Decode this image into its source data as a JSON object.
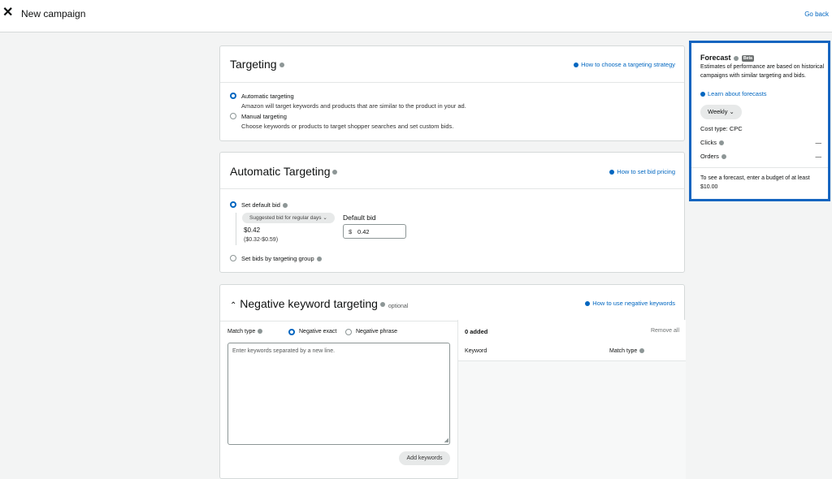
{
  "header": {
    "close_icon": "close-icon",
    "title": "New campaign",
    "go_back": "Go back"
  },
  "targeting": {
    "title": "Targeting",
    "help_link": "How to choose a targeting strategy",
    "options": [
      {
        "label": "Automatic targeting",
        "desc": "Amazon will target keywords and products that are similar to the product in your ad.",
        "selected": true
      },
      {
        "label": "Manual targeting",
        "desc": "Choose keywords or products to target shopper searches and set custom bids.",
        "selected": false
      }
    ]
  },
  "auto": {
    "title": "Automatic Targeting",
    "help_link": "How to set bid pricing",
    "default_bid_label": "Set default bid",
    "suggested_dropdown": "Suggested bid for regular days",
    "suggested_value": "$0.42",
    "suggested_range": "($0.32-$0.59)",
    "default_bid_heading": "Default bid",
    "currency": "$",
    "bid_value": "0.42",
    "group_label": "Set bids by targeting group"
  },
  "negative": {
    "title": "Negative keyword targeting",
    "optional": "optional",
    "help_link": "How to use negative keywords",
    "match_type_label": "Match type",
    "exact_label": "Negative exact",
    "phrase_label": "Negative phrase",
    "textarea_placeholder": "Enter keywords separated by a new line.",
    "add_button": "Add keywords",
    "added_count": "0 added",
    "remove_all": "Remove all",
    "col_keyword": "Keyword",
    "col_match_type": "Match type"
  },
  "forecast": {
    "title": "Forecast",
    "badge": "Beta",
    "desc": "Estimates of performance are based on historical campaigns with similar targeting and bids.",
    "learn_link": "Learn about forecasts",
    "period": "Weekly",
    "cost_type": "Cost type: CPC",
    "clicks_label": "Clicks",
    "clicks_value": "—",
    "orders_label": "Orders",
    "orders_value": "—",
    "budget_note": "To see a forecast, enter a budget of at least $10.00"
  },
  "colors": {
    "accent": "#0066c0",
    "forecast_border": "#1565c0"
  }
}
